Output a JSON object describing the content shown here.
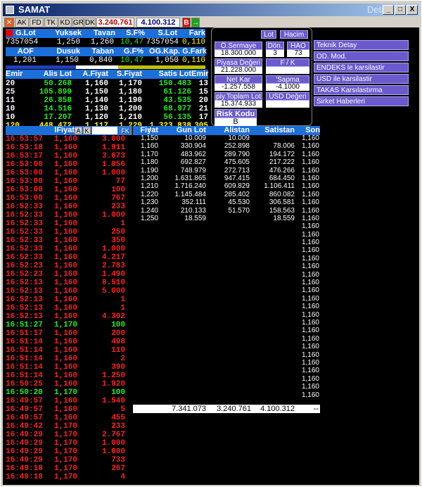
{
  "window": {
    "title": "SAMAT",
    "detay": "Detay",
    "min": "_",
    "max": "□",
    "close": "X"
  },
  "toolbar": {
    "tabs": [
      "AK",
      "FD",
      "TK",
      "KD",
      "GR",
      "DK"
    ],
    "value1": "3.240.761",
    "value2": "4.100.312",
    "b": "B",
    "arrow": "→",
    "x": "✕"
  },
  "summary": {
    "headers1": [
      "G.Lot",
      "Yuksek",
      "Tavan",
      "S.F%",
      "S.Lot",
      "Fark"
    ],
    "values1": [
      "7357054",
      "1,250",
      "1,260",
      "10,47",
      "7357054",
      "0,110"
    ],
    "headers2": [
      "AOF",
      "Dusuk",
      "Taban",
      "G.F%",
      "OG.Kap.",
      "G.Fark"
    ],
    "values2": [
      "1,201",
      "1,150",
      "0,840",
      "10,47",
      "1,050",
      "0,110"
    ]
  },
  "depth": {
    "headers": [
      "Emir",
      "Alis Lot",
      "A.Fiyat",
      "S.Fiyat",
      "Satis Lot",
      "Emir"
    ],
    "rows": [
      [
        "20",
        "50.268",
        "1,160",
        "1,170",
        "150.483",
        "13"
      ],
      [
        "25",
        "105.899",
        "1,150",
        "1,180",
        "61.126",
        "15"
      ],
      [
        "11",
        "26.858",
        "1,140",
        "1,190",
        "43.535",
        "20"
      ],
      [
        "10",
        "14.516",
        "1,130",
        "1,200",
        "68.977",
        "21"
      ],
      [
        "10",
        "17.207",
        "1,120",
        "1,210",
        "56.135",
        "17"
      ]
    ],
    "total": [
      "120",
      "448.472",
      "1,117",
      "1,229",
      "1.323.838",
      "305"
    ]
  },
  "panel": {
    "lot": "Lot",
    "hacim": "Hacim",
    "osermaye_l": "Ö.Sermaye",
    "osermaye_v": "18.300.000",
    "don_l": "Dön.",
    "don_v": "3",
    "hao_l": "HAO",
    "hao_v": "73",
    "piyasa_l": "Piyasa Değeri",
    "piyasa_v": "21.228.000",
    "fk_l": "F / K",
    "fk_v": "",
    "netkar_l": "Net Kar",
    "netkar_v": "-1.257.558",
    "sapma_l": "'Sapma",
    "sapma_v": "-4.1000",
    "piy_l": "piy.Toplam Lot",
    "piy_v": "15.374.933",
    "usd_l": "USD Değeri",
    "usd_v": "",
    "risk_l": "Risk Kodu",
    "risk_v": "B"
  },
  "links": [
    "Teknik Detay",
    "OD. Mod.",
    "ENDEKS le karsilastir",
    "USD ile karsilastir",
    "TAKAS Karsılastırma",
    "Sirket Haberleri"
  ],
  "trades": {
    "headers": {
      "fiyat": "lFiyat",
      "a": "A",
      "k": "K",
      "fk": "FK"
    },
    "times": [
      "16:53:57",
      "16:53:18",
      "16:53:17",
      "16:53:00",
      "16:53:00",
      "16:53:00",
      "16:53:00",
      "16:53:00",
      "16:52:33",
      "16:52:33",
      "16:52:33",
      "16:52:33",
      "16:52:33",
      "16:52:33",
      "16:52:33",
      "16:52:23",
      "16:52:23",
      "16:52:13",
      "16:52:13",
      "16:52:13",
      "16:52:13",
      "16:52:13",
      "16:51:27",
      "16:51:17",
      "16:51:14",
      "16:51:14",
      "16:51:14",
      "16:51:14",
      "16:51:14",
      "16:50:25",
      "16:50:20",
      "16:49:57",
      "16:49:57",
      "16:49:57",
      "16:49:42",
      "16:49:29",
      "16:49:29",
      "16:49:29",
      "16:49:29",
      "16:49:18",
      "16:49:18"
    ],
    "prices": [
      "1,160",
      "1,160",
      "1,160",
      "1,160",
      "1,160",
      "1,160",
      "1,160",
      "1,160",
      "1,160",
      "1,160",
      "1,160",
      "1,160",
      "1,160",
      "1,160",
      "1,160",
      "1,160",
      "1,160",
      "1,160",
      "1,160",
      "1,160",
      "1,160",
      "1,160",
      "1,170",
      "1,160",
      "1,160",
      "1,160",
      "1,160",
      "1,160",
      "1,160",
      "1,160",
      "1,170",
      "1,160",
      "1,160",
      "1,160",
      "1,170",
      "1,170",
      "1,170",
      "1,170",
      "1,170",
      "1,170",
      "1,170"
    ],
    "lots": [
      "3.000",
      "1.911",
      "3.673",
      "1.056",
      "1.000",
      "77",
      "100",
      "767",
      "233",
      "1.000",
      "1",
      "250",
      "350",
      "1.000",
      "4.217",
      "2.783",
      "1.490",
      "8.510",
      "5.000",
      "1",
      "1",
      "4.302",
      "100",
      "200",
      "498",
      "110",
      "2",
      "390",
      "1.250",
      "1.920",
      "100",
      "1.540",
      "5",
      "455",
      "233",
      "2.767",
      "1.000",
      "1.000",
      "733",
      "267",
      "4"
    ],
    "green": [
      22,
      30
    ]
  },
  "orderbook": {
    "headers": [
      "Fiyat",
      "Gun Lot",
      "Alistan",
      "Satistan",
      "Son"
    ],
    "fiyat": [
      "1,150",
      "1,160",
      "1,170",
      "1,180",
      "1,190",
      "1,200",
      "1,210",
      "1,220",
      "1,230",
      "1,240",
      "1,250"
    ],
    "gunlot": [
      "10.009",
      "330.904",
      "483.962",
      "692.827",
      "748.979",
      "1.631.865",
      "1.716.240",
      "1.145.484",
      "352.111",
      "210.133",
      "18.559"
    ],
    "alistan": [
      "10.009",
      "252.898",
      "289.790",
      "475.605",
      "272.713",
      "947.415",
      "609.829",
      "285.402",
      "45.530",
      "51.570",
      ""
    ],
    "satistan": [
      "",
      "78.006",
      "194.172",
      "217.222",
      "476.266",
      "684.450",
      "1.106.411",
      "860.082",
      "306.581",
      "158.563",
      "18.559"
    ],
    "son": [
      "1,160",
      "1,160",
      "1,160",
      "1,160",
      "1,160",
      "1,160",
      "1,160",
      "1,160",
      "1,160",
      "1,160",
      "1,160",
      "1,160",
      "1,160",
      "1,160",
      "1,160",
      "1,160",
      "1,160",
      "1,160",
      "1,160",
      "1,160",
      "1,160",
      "1,160",
      "1,160",
      "1,160",
      "1,160",
      "1,160",
      "1,160",
      "1,160",
      "1,160",
      "1,160",
      "1,160",
      "1,160",
      "1,160"
    ],
    "totals": [
      "7.341.073",
      "3.240.761",
      "4.100.312",
      "--"
    ]
  }
}
